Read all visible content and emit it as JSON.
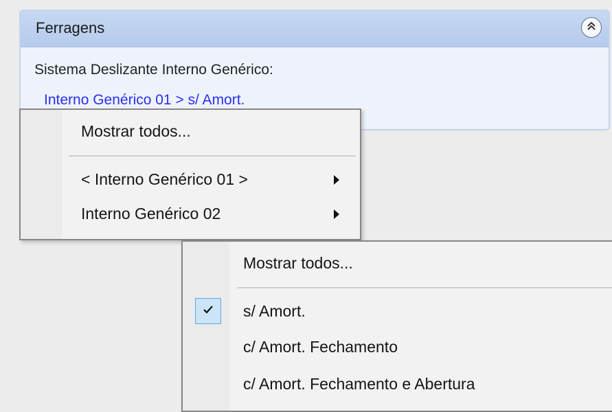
{
  "panel": {
    "title": "Ferragens",
    "collapse_icon": "double-chevron-up-icon",
    "label": "Sistema Deslizante Interno Genérico:",
    "link": "Interno Genérico 01 > s/ Amort."
  },
  "menu1": {
    "items": [
      {
        "label": "Mostrar todos...",
        "submenu": false
      },
      {
        "label": "< Interno Genérico 01 >",
        "submenu": true
      },
      {
        "label": "Interno Genérico 02",
        "submenu": true
      }
    ]
  },
  "menu2": {
    "items": [
      {
        "label": "Mostrar todos...",
        "checked": false
      },
      {
        "label": "s/ Amort.",
        "checked": true
      },
      {
        "label": "c/ Amort. Fechamento",
        "checked": false
      },
      {
        "label": "c/ Amort. Fechamento e Abertura",
        "checked": false
      }
    ]
  },
  "colors": {
    "link": "#2a2ff0",
    "header": "#b5cbec",
    "check_bg": "#cce4f7"
  }
}
